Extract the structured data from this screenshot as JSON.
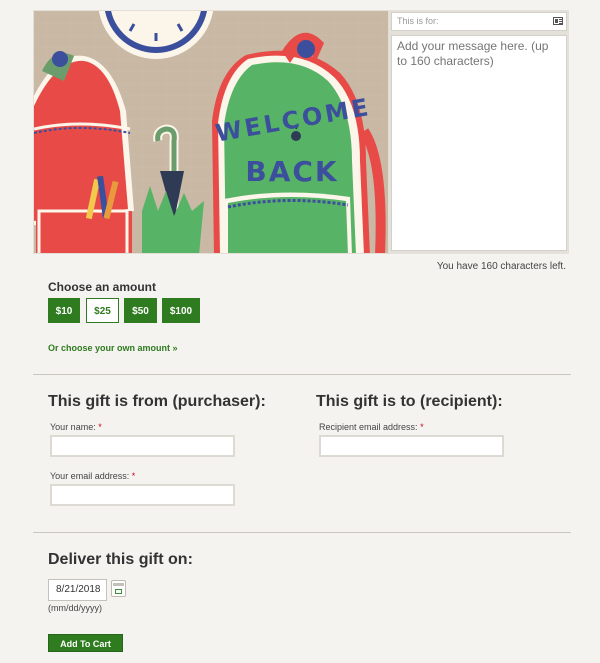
{
  "card": {
    "art_text_line1": "WELCOME",
    "art_text_line2": "BACK"
  },
  "message": {
    "to_placeholder": "This is for:",
    "message_placeholder": "Add your message here. (up to 160 characters)",
    "chars_left": "You have 160 characters left."
  },
  "amount": {
    "label": "Choose an amount",
    "options": [
      "$10",
      "$25",
      "$50",
      "$100"
    ],
    "selected": "$25",
    "own_amount_link": "Or choose your own amount »"
  },
  "from": {
    "heading": "This gift is from (purchaser):",
    "name_label": "Your name:",
    "email_label": "Your email address:",
    "required_mark": "*"
  },
  "to": {
    "heading": "This gift is to (recipient):",
    "email_label": "Recipient email address:",
    "required_mark": "*"
  },
  "deliver": {
    "heading": "Deliver this gift on:",
    "date_value": "8/21/2018",
    "date_hint": "(mm/dd/yyyy)"
  },
  "cart": {
    "button_label": "Add To Cart"
  },
  "colors": {
    "accent_green": "#2f7b1f",
    "required_red": "#d0021b"
  }
}
